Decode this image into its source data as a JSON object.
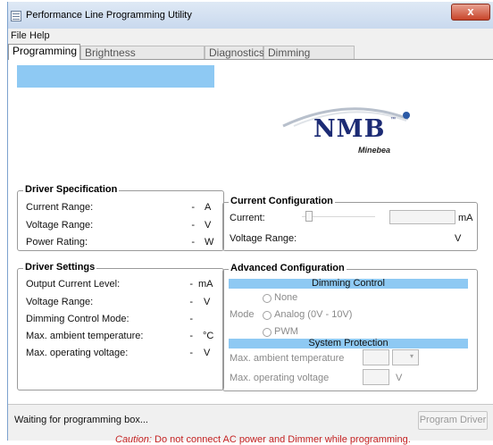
{
  "window": {
    "title": "Performance Line Programming Utility",
    "close_glyph": "x"
  },
  "menu": [
    "File",
    "Help"
  ],
  "tabs": [
    "Programming",
    "Brightness Compensation",
    "Diagnostics",
    "Dimming Selector"
  ],
  "logo": {
    "text": "NMB",
    "tm": "™",
    "sub": "Minebea"
  },
  "driver_spec": {
    "title": "Driver Specification",
    "rows": [
      {
        "label": "Current Range:",
        "value": "-",
        "unit": "A"
      },
      {
        "label": "Voltage Range:",
        "value": "-",
        "unit": "V"
      },
      {
        "label": "Power Rating:",
        "value": "-",
        "unit": "W"
      }
    ]
  },
  "driver_settings": {
    "title": "Driver Settings",
    "rows": [
      {
        "label": "Output Current Level:",
        "value": "-",
        "unit": "mA"
      },
      {
        "label": "Voltage Range:",
        "value": "-",
        "unit": "V"
      },
      {
        "label": "Dimming Control Mode:",
        "value": "-",
        "unit": ""
      },
      {
        "label": "Max. ambient temperature:",
        "value": "-",
        "unit": "°C"
      },
      {
        "label": "Max. operating voltage:",
        "value": "-",
        "unit": "V"
      }
    ]
  },
  "current_config": {
    "title": "Current Configuration",
    "current_label": "Current:",
    "current_unit": "mA",
    "voltage_label": "Voltage Range:",
    "voltage_unit": "V"
  },
  "advanced_config": {
    "title": "Advanced Configuration",
    "dimming_header": "Dimming Control",
    "mode_label": "Mode",
    "options": [
      "None",
      "Analog (0V - 10V)",
      "PWM"
    ],
    "protection_header": "System Protection",
    "ambient_label": "Max. ambient temperature",
    "operating_label": "Max. operating voltage",
    "operating_unit": "V"
  },
  "status": {
    "text": "Waiting for programming box...",
    "program_button": "Program Driver",
    "caution_label": "Caution:",
    "caution_text": " Do not connect AC power and Dimmer while programming."
  }
}
